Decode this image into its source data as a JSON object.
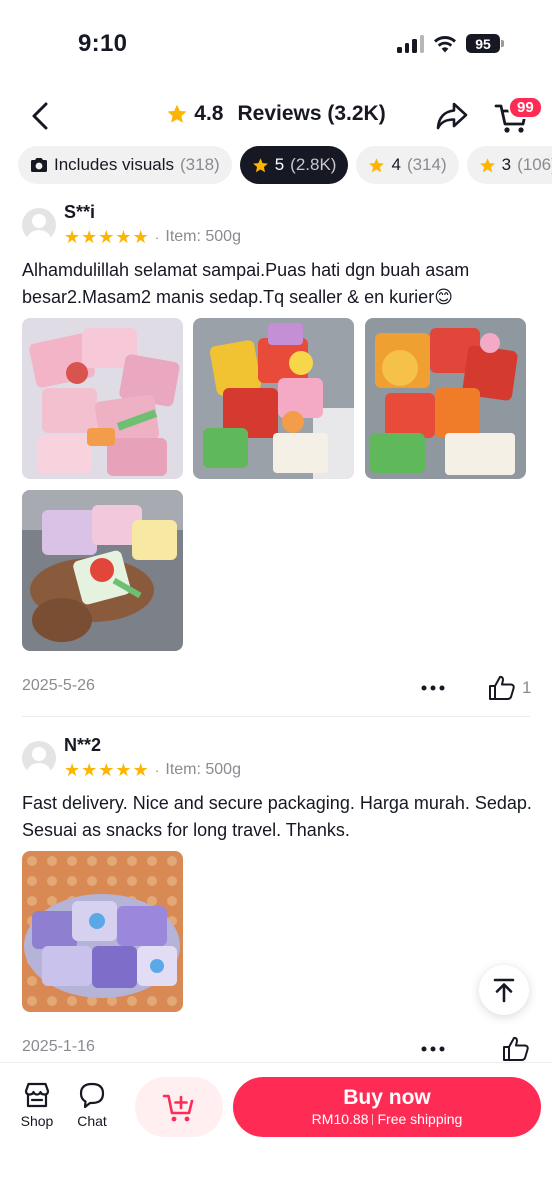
{
  "status_bar": {
    "time": "9:10",
    "battery": "95"
  },
  "header": {
    "rating": "4.8",
    "title": "Reviews (3.2K)",
    "cart_badge": "99"
  },
  "filters": [
    {
      "label": "Includes visuals",
      "count": "(318)",
      "icon": "camera-icon"
    },
    {
      "label": "5",
      "count": "(2.8K)",
      "icon": "star-icon",
      "active": true
    },
    {
      "label": "4",
      "count": "(314)",
      "icon": "star-icon"
    },
    {
      "label": "3",
      "count": "(106)",
      "icon": "star-icon"
    }
  ],
  "reviews": [
    {
      "name": "S**i",
      "stars": 5,
      "separator": "·",
      "variant": "Item: 500g",
      "text": "Alhamdulillah selamat sampai.Puas hati dgn buah asam besar2.Masam2 manis sedap.Tq sealler & en kurier😊",
      "photo_count": 4,
      "date": "2025-5-26",
      "likes": "1"
    },
    {
      "name": "N**2",
      "stars": 5,
      "separator": "·",
      "variant": "Item: 500g",
      "text": "Fast delivery. Nice and secure packaging. Harga murah. Sedap. Sesuai as snacks for long travel. Thanks.",
      "photo_count": 1,
      "date": "2025-1-16",
      "likes": ""
    }
  ],
  "bottom_bar": {
    "shop_label": "Shop",
    "chat_label": "Chat",
    "buy_label": "Buy now",
    "price": "RM10.88",
    "shipping": "Free shipping"
  },
  "colors": {
    "accent": "#fe2c55",
    "star": "#fcb500",
    "muted": "#8a8b91"
  }
}
